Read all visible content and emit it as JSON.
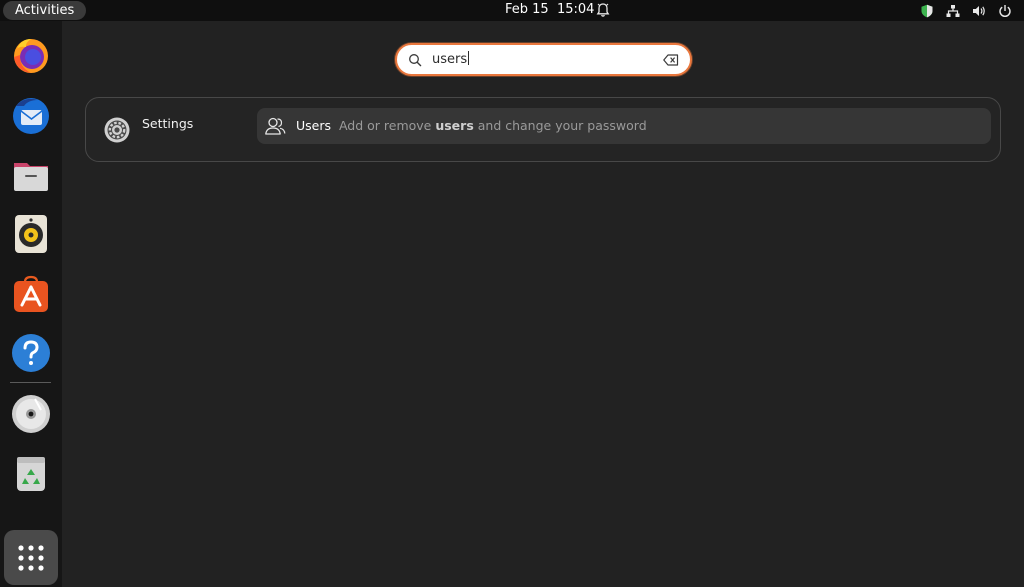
{
  "topbar": {
    "activities_label": "Activities",
    "clock": "Feb 15  15:04",
    "icons": [
      "bell-icon",
      "shield-icon",
      "network-icon",
      "volume-icon",
      "power-icon"
    ]
  },
  "dock": {
    "items": [
      "firefox-icon",
      "thunderbird-icon",
      "files-icon",
      "rhythmbox-icon",
      "app-center-icon",
      "help-icon",
      "disc-icon",
      "trash-icon"
    ],
    "apps_grid": "show-apps-grid-icon"
  },
  "search": {
    "query": "users",
    "icon": "search-icon",
    "clear_icon": "clear-text-icon",
    "accent": "#e9773d"
  },
  "results": {
    "provider": "Settings",
    "provider_icon": "gear-icon",
    "item": {
      "icon": "users-icon",
      "title": "Users",
      "desc_before": "Add or remove ",
      "desc_match": "users",
      "desc_after": " and change your password"
    }
  }
}
